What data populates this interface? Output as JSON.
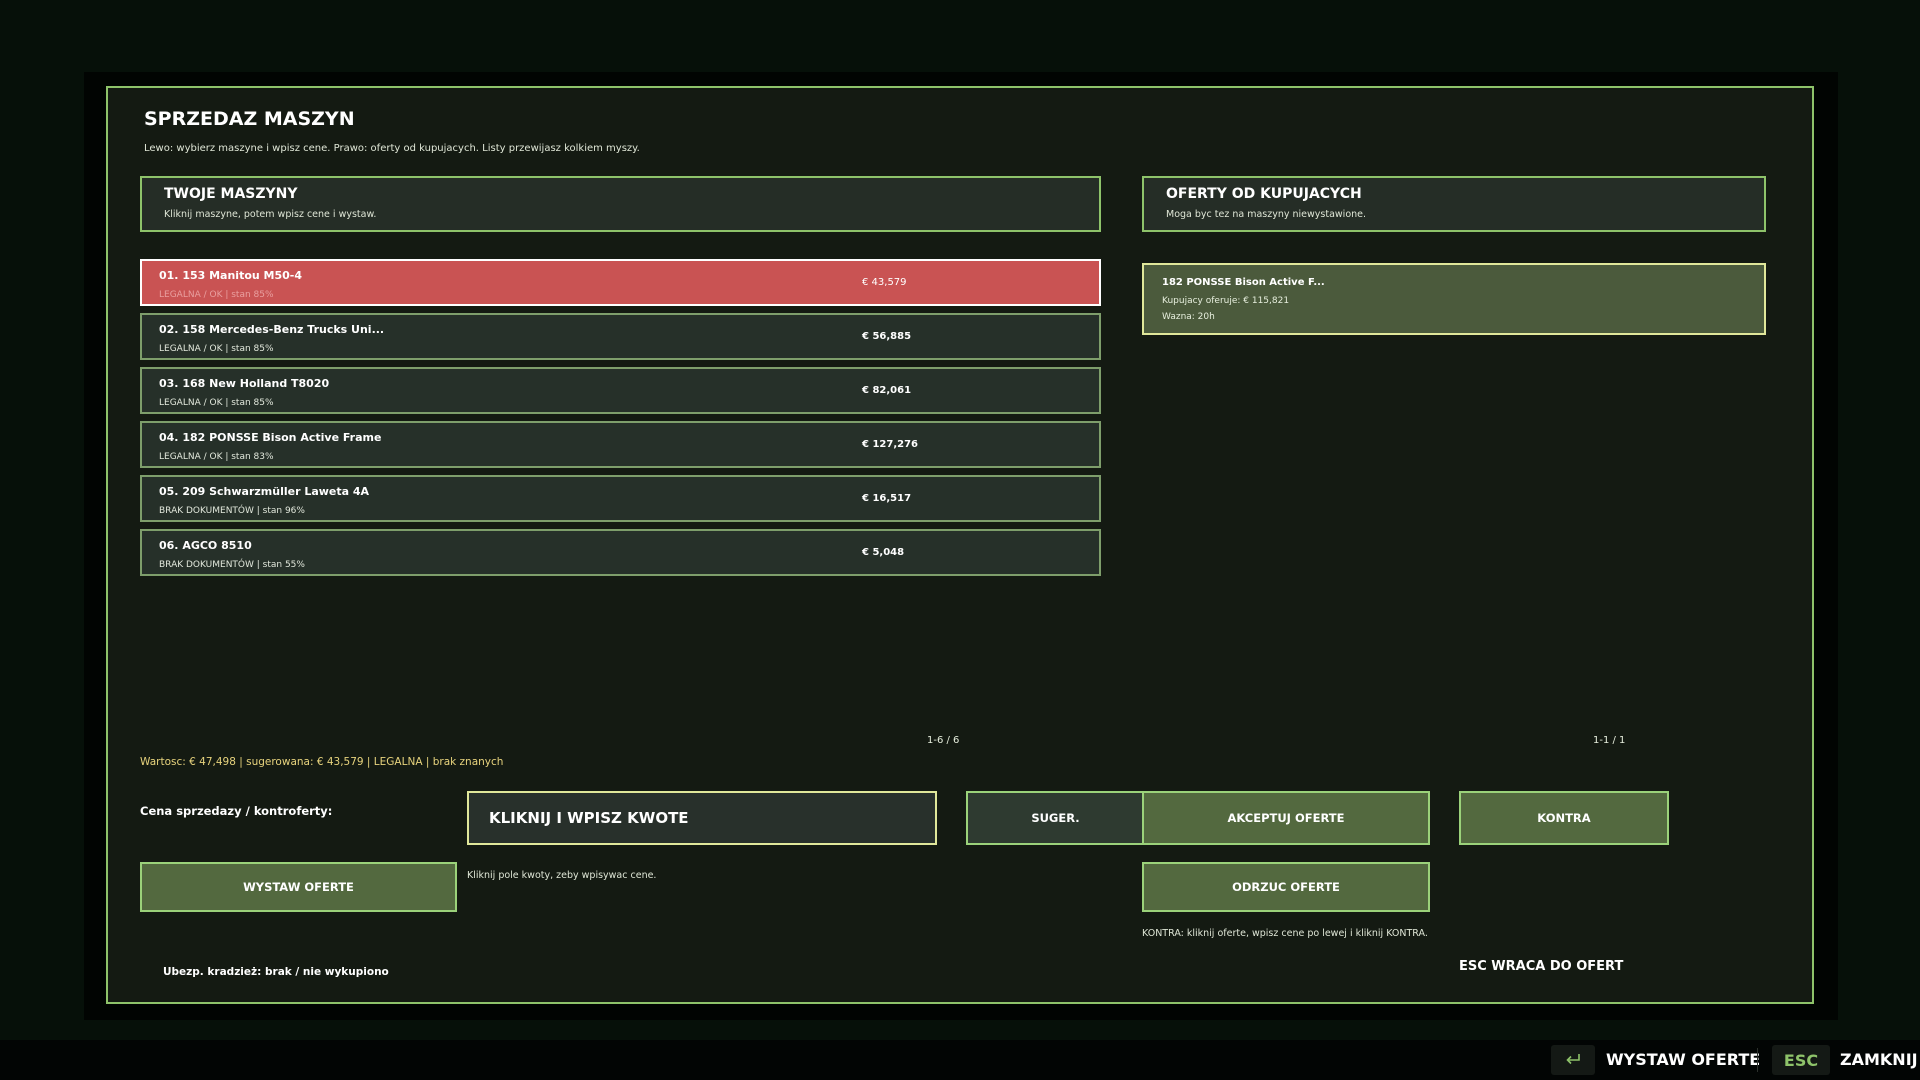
{
  "title": "SPRZEDAZ MASZYN",
  "subtitle": "Lewo: wybierz maszyne i wpisz cene. Prawo: oferty od kupujacych. Listy przewijasz kolkiem myszy.",
  "left_panel": {
    "title": "TWOJE MASZYNY",
    "desc": "Kliknij maszyne, potem wpisz cene i wystaw."
  },
  "right_panel": {
    "title": "OFERTY OD KUPUJACYCH",
    "desc": "Moga byc tez na maszyny niewystawione."
  },
  "machines": [
    {
      "name": "01. 153 Manitou M50-4",
      "status": "LEGALNA / OK | stan 85%",
      "price": "€ 43,579",
      "selected": true
    },
    {
      "name": "02. 158 Mercedes-Benz Trucks Uni...",
      "status": "LEGALNA / OK | stan 85%",
      "price": "€ 56,885",
      "selected": false
    },
    {
      "name": "03. 168 New Holland T8020",
      "status": "LEGALNA / OK | stan 85%",
      "price": "€ 82,061",
      "selected": false
    },
    {
      "name": "04. 182 PONSSE Bison Active Frame",
      "status": "LEGALNA / OK | stan 83%",
      "price": "€ 127,276",
      "selected": false
    },
    {
      "name": "05. 209 Schwarzmüller Laweta 4A",
      "status": "BRAK DOKUMENTÓW | stan 96%",
      "price": "€ 16,517",
      "selected": false
    },
    {
      "name": "06. AGCO 8510",
      "status": "BRAK DOKUMENTÓW | stan 55%",
      "price": "€ 5,048",
      "selected": false
    }
  ],
  "offers": [
    {
      "name": "182 PONSSE Bison Active F...",
      "offer_line": "Kupujacy oferuje: € 115,821",
      "valid_line": "Wazna: 20h"
    }
  ],
  "machines_pager": "1-6 / 6",
  "offers_pager": "1-1 / 1",
  "summary": "Wartosc: € 47,498 | sugerowana: € 43,579 | LEGALNA | brak znanych",
  "price_label": "Cena sprzedazy / kontroferty:",
  "price_input_text": "KLIKNIJ I WPISZ KWOTE",
  "price_hint": "Kliknij pole kwoty, zeby wpisywac cene.",
  "buttons": {
    "suggest": "SUGER.",
    "accept": "AKCEPTUJ OFERTE",
    "counter": "KONTRA",
    "list": "WYSTAW OFERTE",
    "reject": "ODRZUC OFERTE"
  },
  "counter_hint": "KONTRA: kliknij oferte, wpisz cene po lewej i kliknij KONTRA.",
  "insurance": "Ubezp. kradzież: brak / nie wykupiono",
  "esc_back": "ESC WRACA DO OFERT",
  "bottom_bar": {
    "enter_icon": "enter-icon",
    "action_label": "WYSTAW OFERTE",
    "esc_key": "ESC",
    "close_label": "ZAMKNIJ"
  },
  "colors": {
    "accent": "#8ec36a",
    "selected": "#c95353",
    "button": "#53693f",
    "highlight": "#e0e79a",
    "summary": "#e7d37d"
  }
}
